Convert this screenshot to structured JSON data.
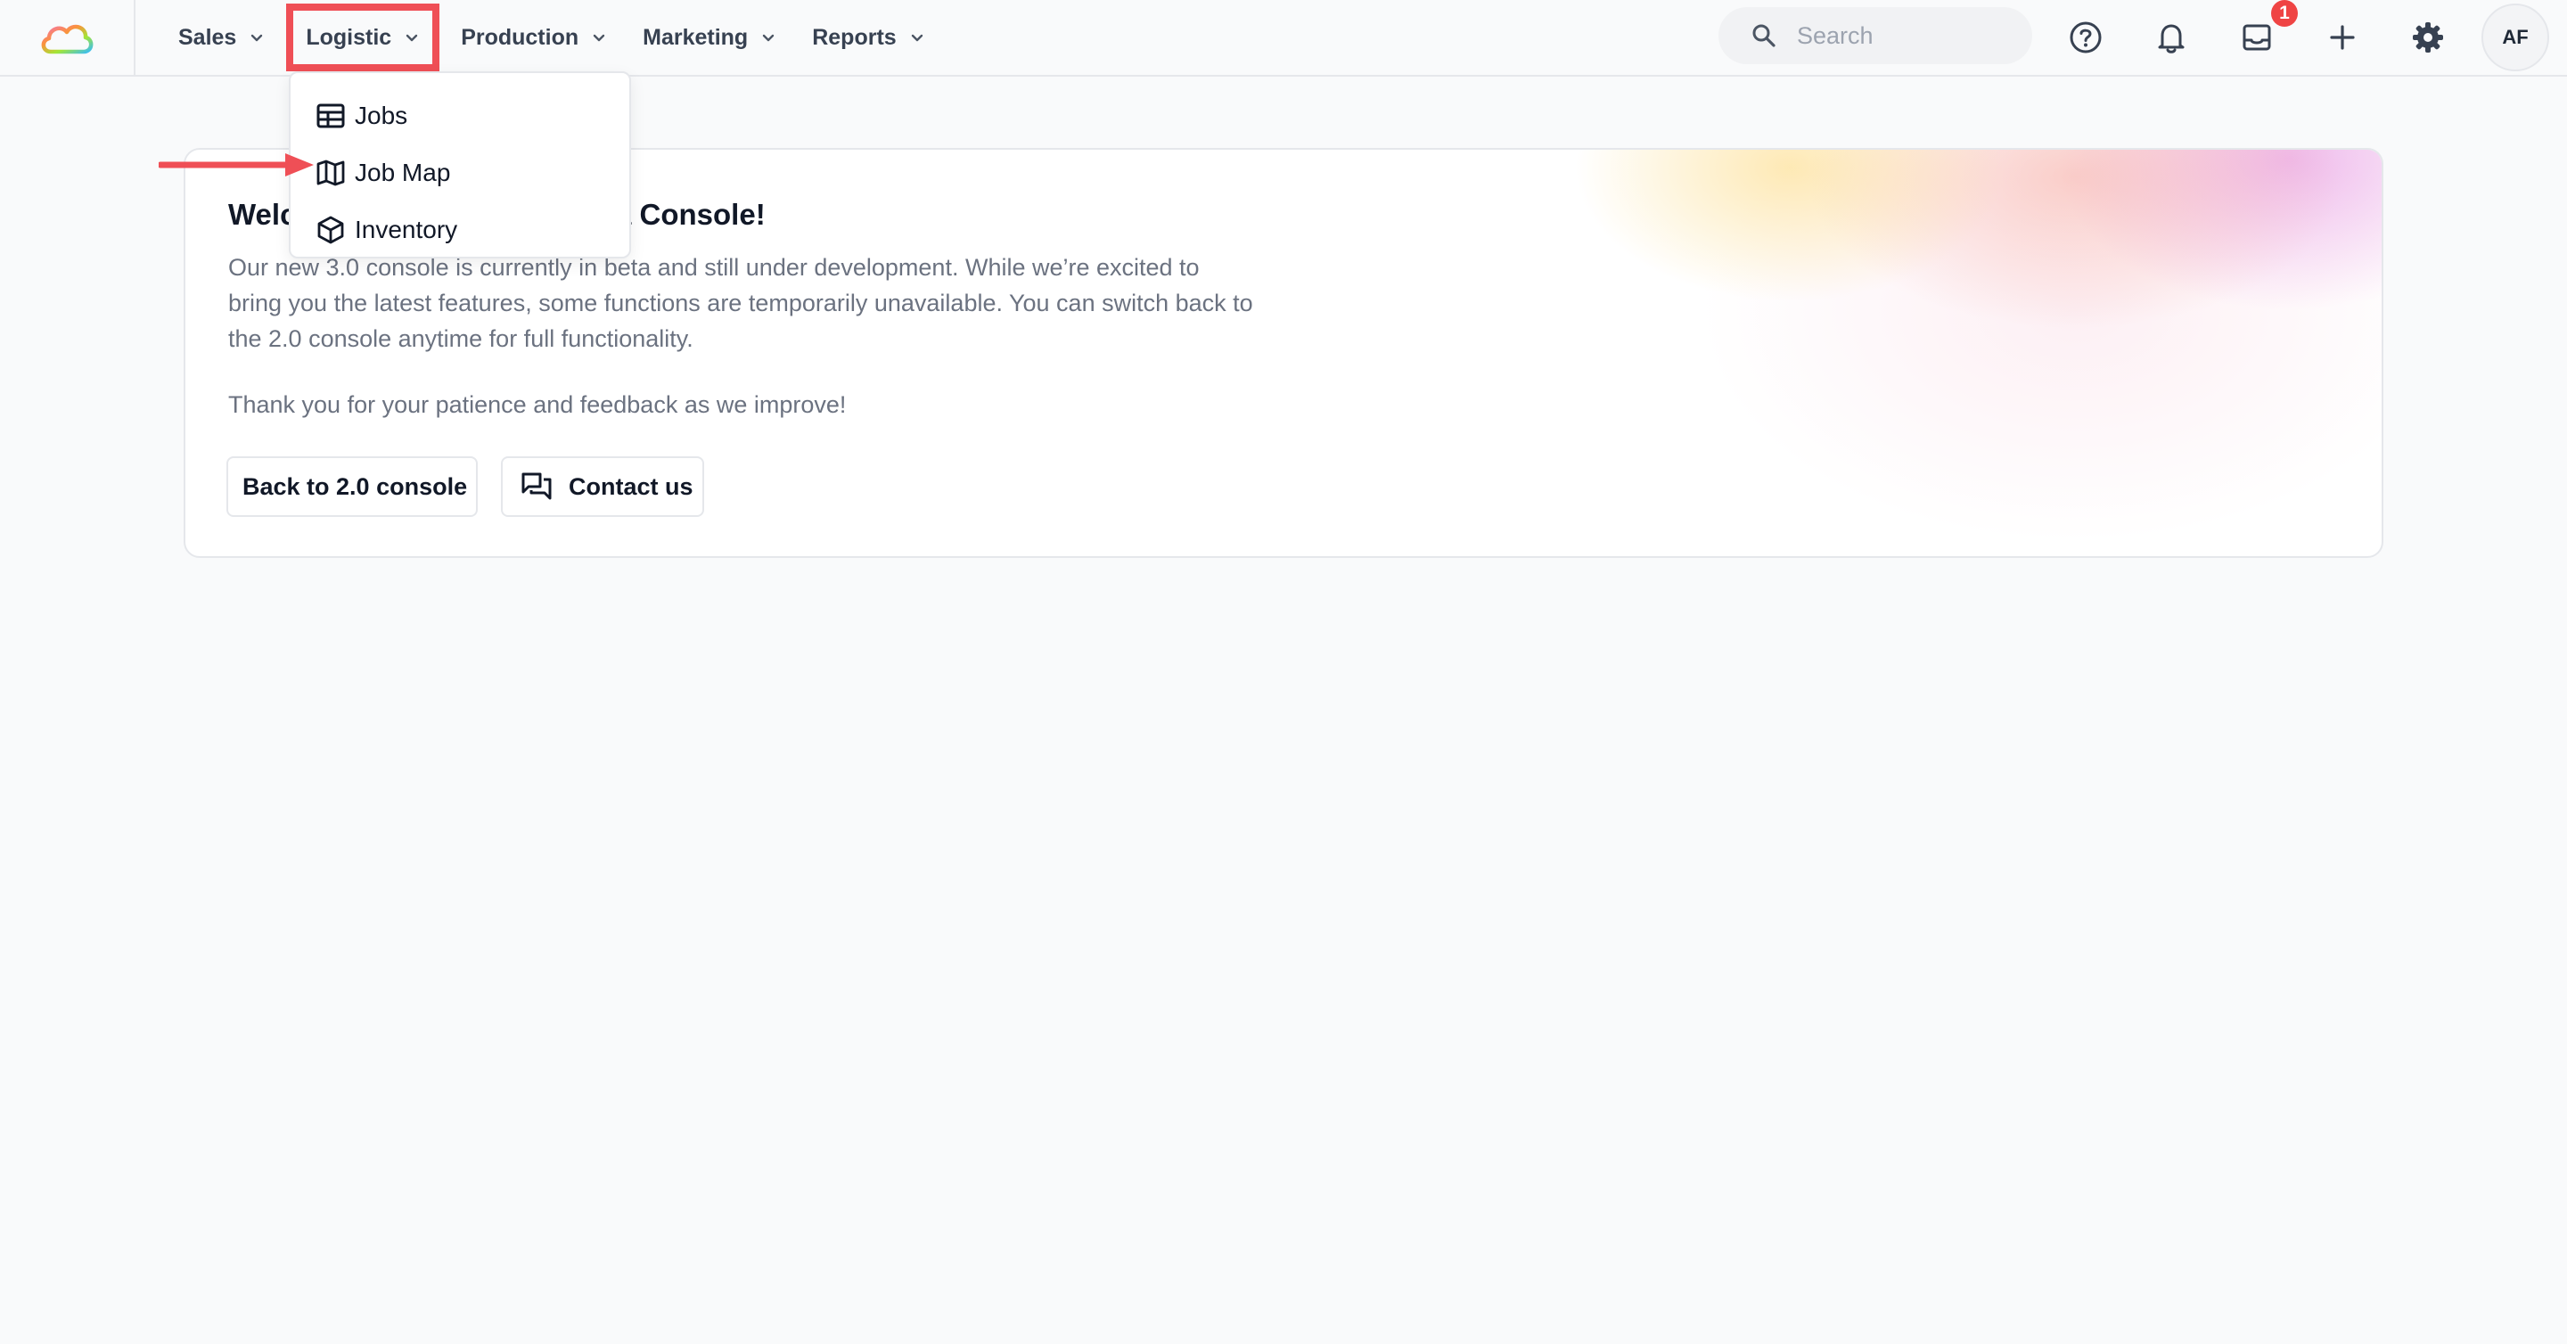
{
  "nav": {
    "items": [
      {
        "label": "Sales"
      },
      {
        "label": "Logistic"
      },
      {
        "label": "Production"
      },
      {
        "label": "Marketing"
      },
      {
        "label": "Reports"
      }
    ],
    "active": "Logistic"
  },
  "search": {
    "placeholder": "Search"
  },
  "notifications": {
    "inbox_badge": "1"
  },
  "user": {
    "initials": "AF"
  },
  "dropdown": {
    "items": [
      {
        "label": "Jobs",
        "icon": "table-icon"
      },
      {
        "label": "Job Map",
        "icon": "map-icon"
      },
      {
        "label": "Inventory",
        "icon": "box-icon"
      }
    ]
  },
  "welcome": {
    "title": "Welcome to the new 3.0 Beta Console!",
    "body": "Our new 3.0 console is currently in beta and still under development. While we’re excited to bring you the latest features, some functions are temporarily unavailable. You can switch back to the 2.0 console anytime for full functionality.",
    "thanks": "Thank you for your patience and feedback as we improve!",
    "back_button": "Back to 2.0 console",
    "contact_button": "Contact us"
  },
  "colors": {
    "highlight": "#ef4f56",
    "badge": "#ef4444",
    "background": "#f9fafb"
  }
}
